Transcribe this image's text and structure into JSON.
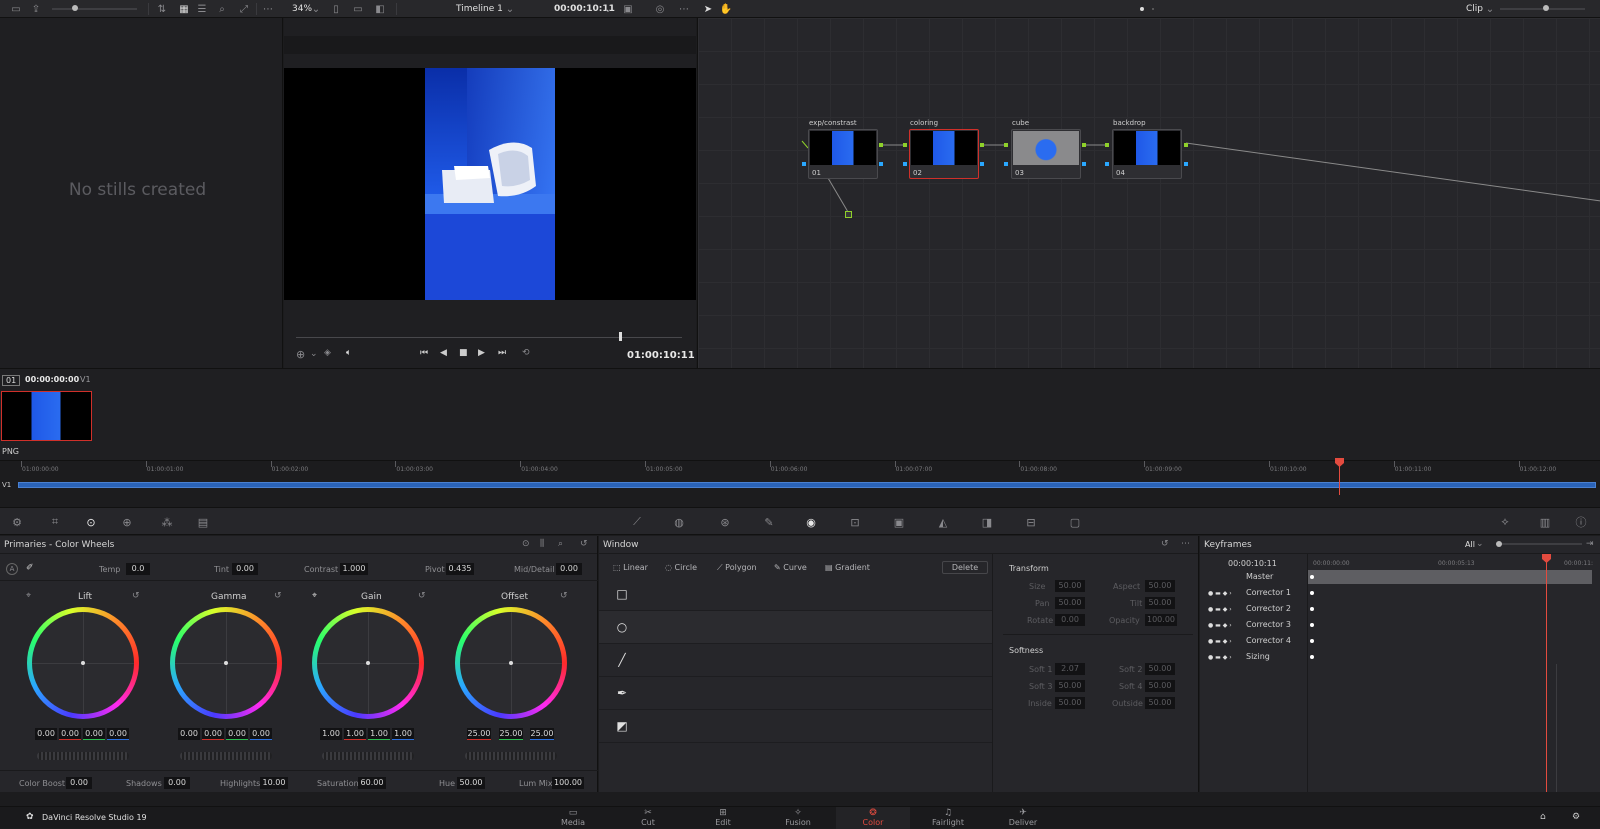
{
  "topbar": {
    "zoom": "34%",
    "timeline_name": "Timeline 1",
    "timecode": "00:00:10:11",
    "mode": "Clip"
  },
  "stills": {
    "empty_text": "No stills created"
  },
  "viewer": {
    "timecode": "01:00:10:11"
  },
  "nodes": [
    {
      "title": "exp/constrast",
      "label": "01"
    },
    {
      "title": "coloring",
      "label": "02"
    },
    {
      "title": "cube",
      "label": "03"
    },
    {
      "title": "backdrop",
      "label": "04"
    }
  ],
  "clip": {
    "index": "01",
    "timecode": "00:00:00:00",
    "track": "V1",
    "format": "PNG"
  },
  "ruler": {
    "ticks": [
      "01:00:00:00",
      "01:00:01:00",
      "01:00:02:00",
      "01:00:03:00",
      "01:00:04:00",
      "01:00:05:00",
      "01:00:06:00",
      "01:00:07:00",
      "01:00:08:00",
      "01:00:09:00",
      "01:00:10:00",
      "01:00:11:00",
      "01:00:12:00"
    ],
    "track": "V1"
  },
  "primaries": {
    "title": "Primaries - Color Wheels",
    "temp_label": "Temp",
    "temp": "0.0",
    "tint_label": "Tint",
    "tint": "0.00",
    "contrast_label": "Contrast",
    "contrast": "1.000",
    "pivot_label": "Pivot",
    "pivot": "0.435",
    "middetail_label": "Mid/Detail",
    "middetail": "0.00",
    "wheels": [
      {
        "name": "Lift",
        "values": [
          "0.00",
          "0.00",
          "0.00",
          "0.00"
        ]
      },
      {
        "name": "Gamma",
        "values": [
          "0.00",
          "0.00",
          "0.00",
          "0.00"
        ]
      },
      {
        "name": "Gain",
        "values": [
          "1.00",
          "1.00",
          "1.00",
          "1.00"
        ]
      },
      {
        "name": "Offset",
        "values": [
          "25.00",
          "25.00",
          "25.00"
        ]
      }
    ],
    "colorboost_label": "Color Boost",
    "colorboost": "0.00",
    "shadows_label": "Shadows",
    "shadows": "0.00",
    "highlights_label": "Highlights",
    "highlights": "10.00",
    "saturation_label": "Saturation",
    "saturation": "60.00",
    "hue_label": "Hue",
    "hue": "50.00",
    "lummix_label": "Lum Mix",
    "lummix": "100.00"
  },
  "window": {
    "title": "Window",
    "tools": [
      "Linear",
      "Circle",
      "Polygon",
      "Curve",
      "Gradient"
    ],
    "delete_label": "Delete",
    "transform_title": "Transform",
    "size_label": "Size",
    "size": "50.00",
    "aspect_label": "Aspect",
    "aspect": "50.00",
    "pan_label": "Pan",
    "pan": "50.00",
    "tilt_label": "Tilt",
    "tilt": "50.00",
    "rotate_label": "Rotate",
    "rotate": "0.00",
    "opacity_label": "Opacity",
    "opacity": "100.00",
    "softness_title": "Softness",
    "soft1_label": "Soft 1",
    "soft1": "2.07",
    "soft2_label": "Soft 2",
    "soft2": "50.00",
    "soft3_label": "Soft 3",
    "soft3": "50.00",
    "soft4_label": "Soft 4",
    "soft4": "50.00",
    "inside_label": "Inside",
    "inside": "50.00",
    "outside_label": "Outside",
    "outside": "50.00"
  },
  "keyframes": {
    "title": "Keyframes",
    "filter": "All",
    "timecode": "00:00:10:11",
    "ticks": [
      "00:00:00:00",
      "00:00:05:13",
      "00:00:11:"
    ],
    "rows": [
      "Master",
      "Corrector 1",
      "Corrector 2",
      "Corrector 3",
      "Corrector 4",
      "Sizing"
    ]
  },
  "app": {
    "name": "DaVinci Resolve Studio 19"
  },
  "pages": [
    "Media",
    "Cut",
    "Edit",
    "Fusion",
    "Color",
    "Fairlight",
    "Deliver"
  ],
  "active_page": "Color",
  "colors": {
    "accent": "#e34b3f",
    "node_selected": "#d0302a",
    "port_green": "#8fd12a",
    "port_blue": "#2aa8ff"
  },
  "icons": [
    "camera-icon",
    "upload-icon",
    "sort-icon",
    "grid-icon",
    "list-icon",
    "search-icon",
    "fullscreen-icon",
    "more-icon",
    "pointer-icon",
    "hand-icon",
    "play-icon",
    "stop-icon",
    "loop-icon",
    "volume-icon",
    "reset-icon",
    "home-icon",
    "gear-icon",
    "davinci-logo-icon"
  ]
}
